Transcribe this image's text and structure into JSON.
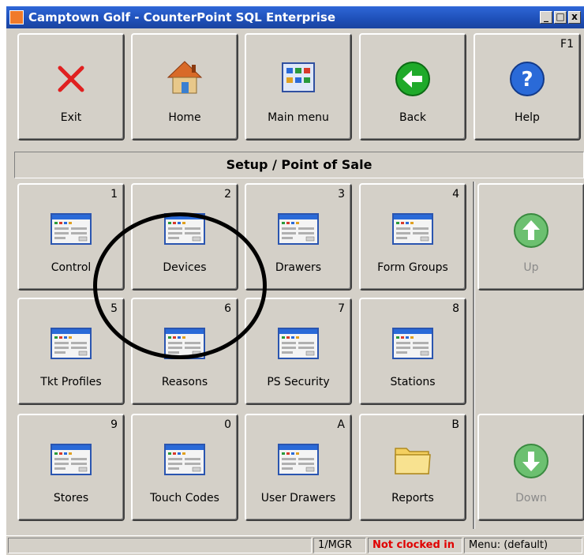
{
  "window": {
    "title": "Camptown Golf - CounterPoint SQL Enterprise",
    "minimize_glyph": "_",
    "maximize_glyph": "□",
    "close_glyph": "x"
  },
  "toolbar": {
    "exit": {
      "label": "Exit",
      "icon": "red-x-icon"
    },
    "home": {
      "label": "Home",
      "icon": "house-icon"
    },
    "main_menu": {
      "label": "Main menu",
      "icon": "menu-grid-icon"
    },
    "back": {
      "label": "Back",
      "icon": "green-left-arrow-icon"
    },
    "help": {
      "label": "Help",
      "hotkey": "F1",
      "icon": "blue-question-icon"
    }
  },
  "section_title": "Setup / Point of Sale",
  "menu_items": [
    {
      "key": "1",
      "label": "Control"
    },
    {
      "key": "2",
      "label": "Devices"
    },
    {
      "key": "3",
      "label": "Drawers"
    },
    {
      "key": "4",
      "label": "Form Groups"
    },
    {
      "key": "5",
      "label": "Tkt Profiles"
    },
    {
      "key": "6",
      "label": "Reasons"
    },
    {
      "key": "7",
      "label": "PS Security"
    },
    {
      "key": "8",
      "label": "Stations"
    },
    {
      "key": "9",
      "label": "Stores"
    },
    {
      "key": "0",
      "label": "Touch Codes"
    },
    {
      "key": "A",
      "label": "User Drawers"
    },
    {
      "key": "B",
      "label": "Reports"
    }
  ],
  "nav": {
    "up": {
      "label": "Up"
    },
    "down": {
      "label": "Down"
    }
  },
  "status_bar": {
    "user": "1/MGR",
    "clock_status": "Not clocked in",
    "menu": "Menu: (default)"
  },
  "colors": {
    "titlebar": "#1e4fb7",
    "face": "#d4d0c8",
    "status_alert": "#e00000",
    "annotation_circle": "#000000"
  }
}
